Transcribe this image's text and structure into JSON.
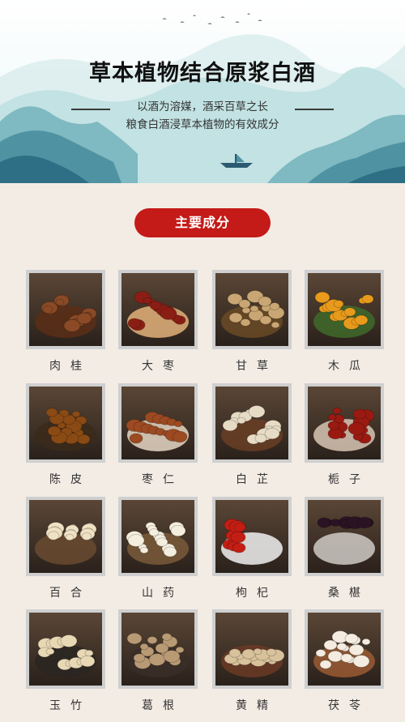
{
  "hero": {
    "title": "草本植物结合原浆白酒",
    "subtitle_line1": "以酒为溶媒，酒采百草之长",
    "subtitle_line2": "粮食白酒浸草本植物的有效成分"
  },
  "section": {
    "heading": "主要成分"
  },
  "ingredients": [
    {
      "name": "肉桂",
      "icon": "cinnamon-photo",
      "colors": [
        "#8a4a26",
        "#5a2e16"
      ]
    },
    {
      "name": "大枣",
      "icon": "jujube-photo",
      "colors": [
        "#8b1e14",
        "#e3b27a"
      ]
    },
    {
      "name": "甘草",
      "icon": "licorice-photo",
      "colors": [
        "#c9a673",
        "#6a4a24"
      ]
    },
    {
      "name": "木瓜",
      "icon": "papaya-photo",
      "colors": [
        "#e89a1c",
        "#3f6a2a"
      ]
    },
    {
      "name": "陈皮",
      "icon": "tangerine-peel-photo",
      "colors": [
        "#8a4a14",
        "#3a2a1a"
      ]
    },
    {
      "name": "枣仁",
      "icon": "jujube-seed-photo",
      "colors": [
        "#9c4a22",
        "#e6d7c4"
      ]
    },
    {
      "name": "白芷",
      "icon": "angelica-photo",
      "colors": [
        "#e6dcc6",
        "#6a3e24"
      ]
    },
    {
      "name": "栀子",
      "icon": "gardenia-photo",
      "colors": [
        "#9a1a12",
        "#d8c6b4"
      ]
    },
    {
      "name": "百合",
      "icon": "lily-bulb-photo",
      "colors": [
        "#efe2c4",
        "#6a4a30"
      ]
    },
    {
      "name": "山药",
      "icon": "yam-photo",
      "colors": [
        "#f4eedf",
        "#7a5a3a"
      ]
    },
    {
      "name": "枸杞",
      "icon": "goji-photo",
      "colors": [
        "#c41e14",
        "#f1f1f1"
      ]
    },
    {
      "name": "桑椹",
      "icon": "mulberry-photo",
      "colors": [
        "#2a1424",
        "#cfcac6"
      ]
    },
    {
      "name": "玉竹",
      "icon": "solomon-seal-photo",
      "colors": [
        "#e8d8b4",
        "#2a2622"
      ]
    },
    {
      "name": "葛根",
      "icon": "kudzu-root-photo",
      "colors": [
        "#b89a74",
        "#3a2e28"
      ]
    },
    {
      "name": "黄精",
      "icon": "polygonatum-photo",
      "colors": [
        "#d8c29c",
        "#6a3a24"
      ]
    },
    {
      "name": "茯苓",
      "icon": "poria-photo",
      "colors": [
        "#f4ece0",
        "#9a5a34"
      ]
    }
  ],
  "colors": {
    "accent": "#c41a18",
    "background": "#f3ece5"
  }
}
